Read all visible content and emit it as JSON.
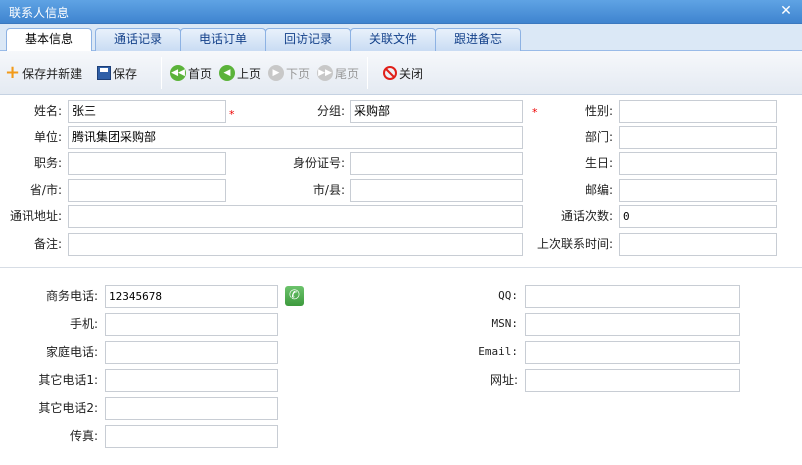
{
  "window": {
    "title": "联系人信息"
  },
  "tabs": [
    {
      "label": "基本信息",
      "active": true
    },
    {
      "label": "通话记录"
    },
    {
      "label": "电话订单"
    },
    {
      "label": "回访记录"
    },
    {
      "label": "关联文件"
    },
    {
      "label": "跟进备忘"
    }
  ],
  "toolbar": {
    "save_new": "保存并新建",
    "save": "保存",
    "first": "首页",
    "prev": "上页",
    "next": "下页",
    "last": "尾页",
    "close": "关闭"
  },
  "basic": {
    "name_label": "姓名:",
    "name_value": "张三",
    "group_label": "分组:",
    "group_value": "采购部",
    "gender_label": "性别:",
    "gender_value": "",
    "company_label": "单位:",
    "company_value": "腾讯集团采购部",
    "dept_label": "部门:",
    "dept_value": "",
    "position_label": "职务:",
    "position_value": "",
    "idcard_label": "身份证号:",
    "idcard_value": "",
    "birthday_label": "生日:",
    "birthday_value": "",
    "province_label": "省/市:",
    "province_value": "",
    "city_label": "市/县:",
    "city_value": "",
    "zip_label": "邮编:",
    "zip_value": "",
    "address_label": "通讯地址:",
    "address_value": "",
    "callcount_label": "通话次数:",
    "callcount_value": "0",
    "remark_label": "备注:",
    "remark_value": "",
    "lastcontact_label": "上次联系时间:",
    "lastcontact_value": ""
  },
  "contact": {
    "biz_phone_label": "商务电话:",
    "biz_phone_value": "12345678",
    "mobile_label": "手机:",
    "mobile_value": "",
    "home_phone_label": "家庭电话:",
    "home_phone_value": "",
    "other1_label": "其它电话1:",
    "other1_value": "",
    "other2_label": "其它电话2:",
    "other2_value": "",
    "fax_label": "传真:",
    "fax_value": "",
    "qq_label": "QQ:",
    "qq_value": "",
    "msn_label": "MSN:",
    "msn_value": "",
    "email_label": "Email:",
    "email_value": "",
    "website_label": "网址:",
    "website_value": ""
  },
  "icons": {
    "dial": "phone-dial-icon",
    "required_mark": "*"
  },
  "colors": {
    "title_bar": "#4a8fd8",
    "required": "#e00000",
    "dial_green": "#3d9a3d"
  }
}
